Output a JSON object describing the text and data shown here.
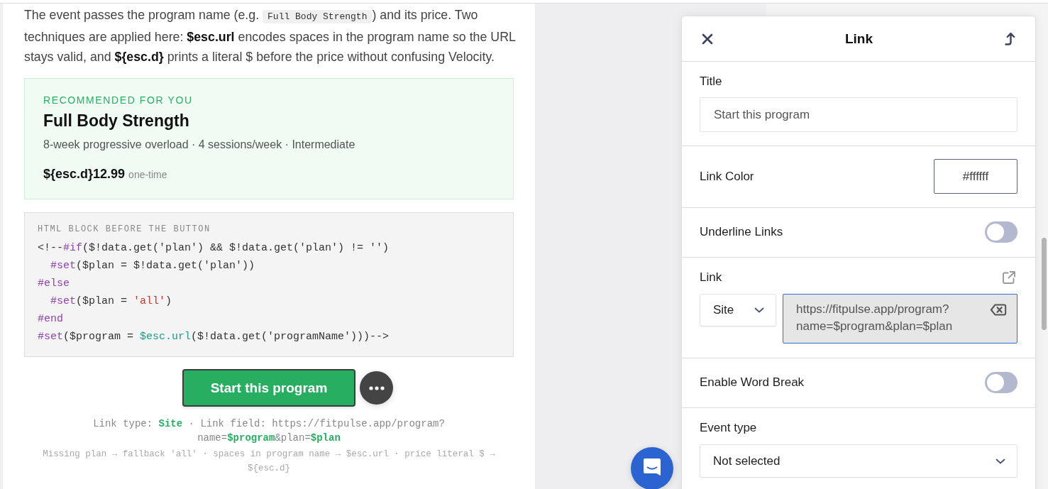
{
  "article": {
    "paragraph": [
      {
        "kind": "text",
        "text": "The event passes the program name (e.g. "
      },
      {
        "kind": "code",
        "text": "Full Body Strength"
      },
      {
        "kind": "text",
        "text": ") and its price. Two techniques are applied here: **$esc.url** encodes spaces in the program name so the URL stays valid, and **${esc.d}** prints a literal $ before the price without confusing Velocity."
      }
    ],
    "card": {
      "eyebrow": "RECOMMENDED FOR YOU",
      "title": "Full Body Strength",
      "details": "8-week progressive overload · 4 sessions/week · Intermediate",
      "price": "${esc.d}12.99",
      "price_note": "one-time"
    },
    "code_block": {
      "label": "HTML BLOCK BEFORE THE BUTTON",
      "lines": [
        {
          "tokens": [
            {
              "kind": "plain",
              "text": "<!--"
            },
            {
              "kind": "directive",
              "text": "#if"
            },
            {
              "kind": "plain",
              "text": "($!data.get('plan') && $!data.get('plan') != '')"
            }
          ]
        },
        {
          "tokens": [
            {
              "kind": "directive",
              "text": "  #set"
            },
            {
              "kind": "plain",
              "text": "($plan = $!data.get('plan'))"
            }
          ]
        },
        {
          "tokens": [
            {
              "kind": "directive",
              "text": "#else"
            }
          ]
        },
        {
          "tokens": [
            {
              "kind": "directive",
              "text": "  #set"
            },
            {
              "kind": "plain",
              "text": "($plan = "
            },
            {
              "kind": "string",
              "text": "'all'"
            },
            {
              "kind": "plain",
              "text": ")"
            }
          ]
        },
        {
          "tokens": [
            {
              "kind": "directive",
              "text": "#end"
            }
          ]
        },
        {
          "tokens": [
            {
              "kind": "directive",
              "text": "#set"
            },
            {
              "kind": "plain",
              "text": "($program = "
            },
            {
              "kind": "function",
              "text": "$esc.url"
            },
            {
              "kind": "plain",
              "text": "($!data.get('programName')))-->"
            }
          ]
        }
      ]
    },
    "button": {
      "label": "Start this program"
    },
    "caption": "Link type: **Site** · Link field: https://fitpulse.app/program?name=**$program**&plan=**$plan**",
    "note": "Missing plan → fallback 'all' · spaces in program name → $esc.url · price literal $ → ${esc.d}"
  },
  "panel": {
    "title": "Link",
    "sections": [
      {
        "kind": "text_field",
        "label": "Title",
        "value": "Start this program"
      },
      {
        "kind": "color",
        "label": "Link Color",
        "value": "#ffffff"
      },
      {
        "kind": "toggle",
        "label": "Underline Links",
        "on": false
      },
      {
        "kind": "link",
        "label": "Link",
        "type": "Site",
        "value": "https://fitpulse.app/program?name=$program&plan=$plan",
        "focused": true
      },
      {
        "kind": "toggle",
        "label": "Enable Word Break",
        "on": false
      },
      {
        "kind": "select",
        "label": "Event type",
        "value": "Not selected"
      }
    ]
  }
}
